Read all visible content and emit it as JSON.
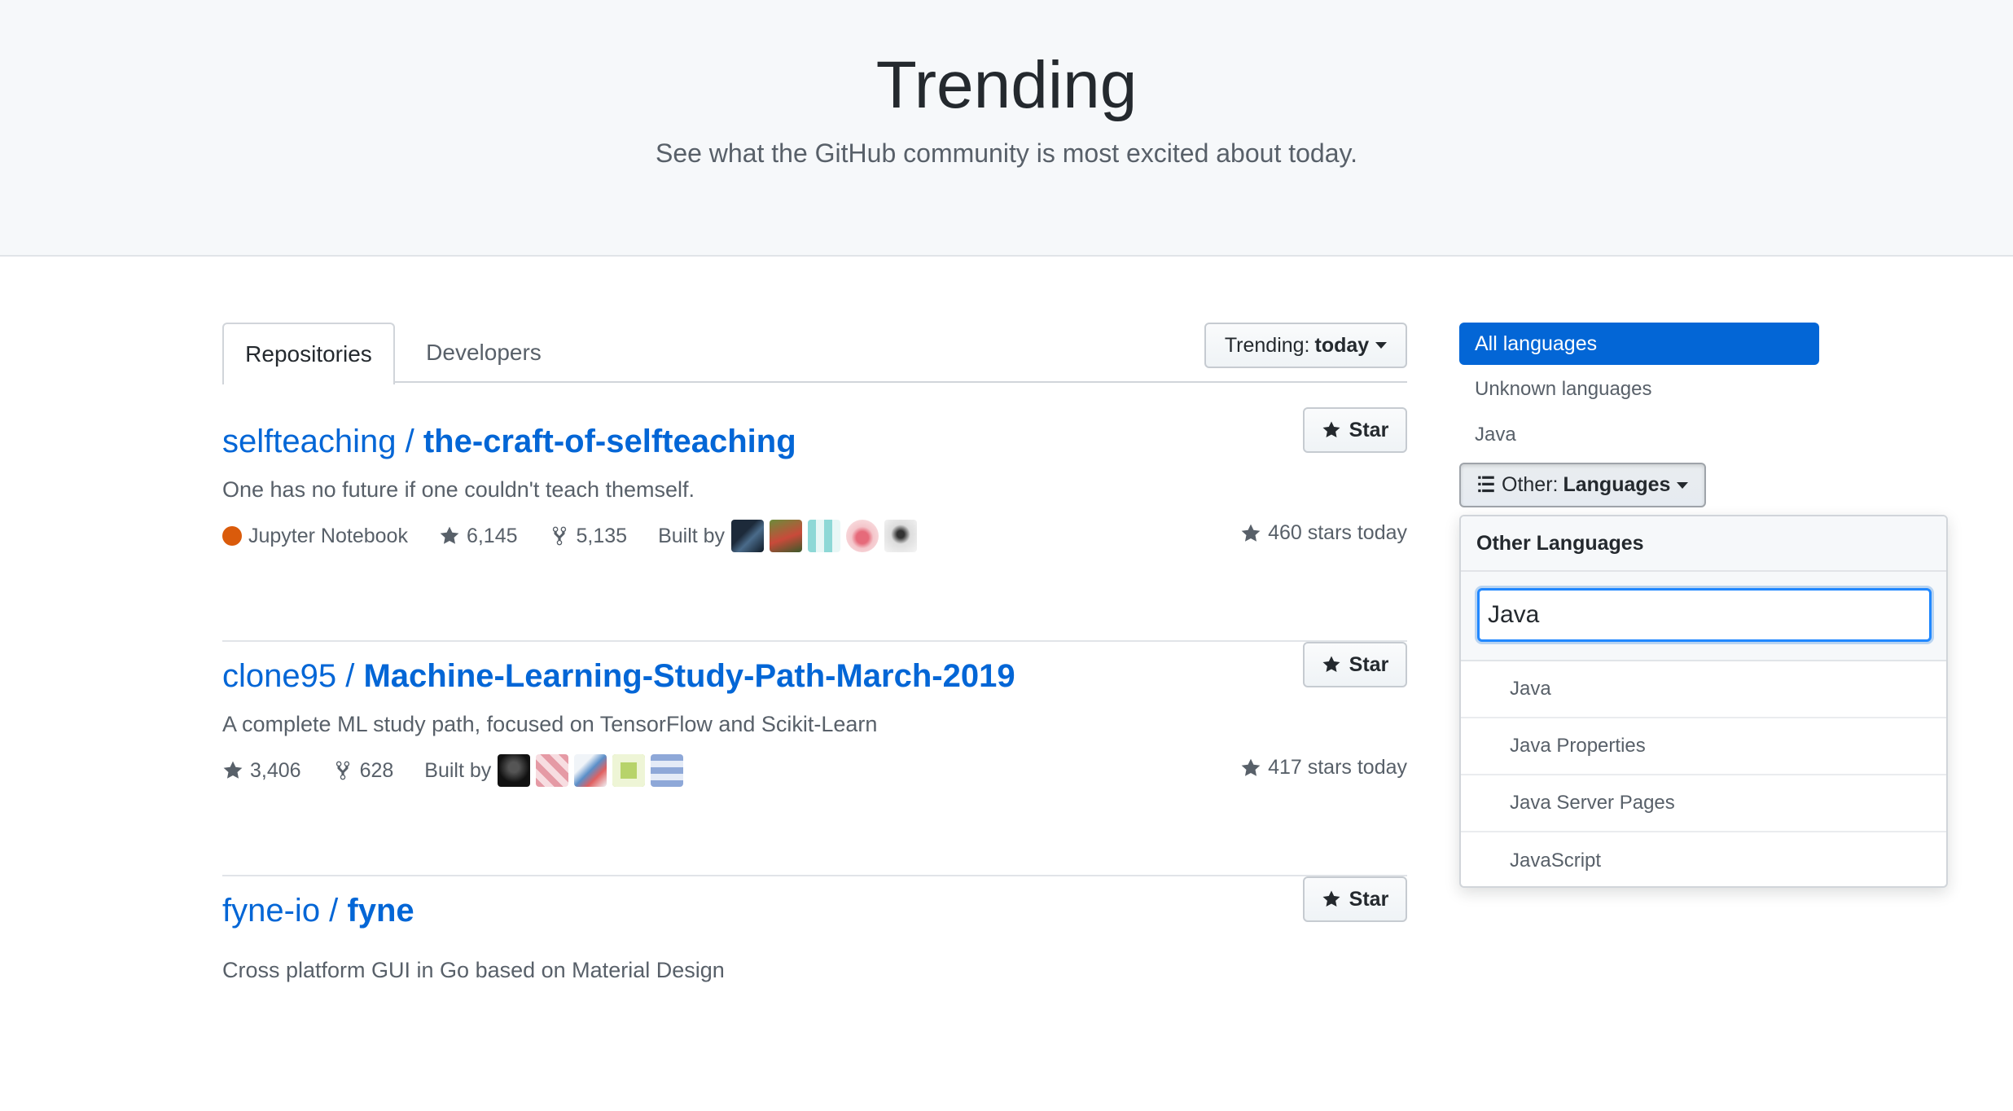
{
  "hero": {
    "title": "Trending",
    "subtitle": "See what the GitHub community is most excited about today."
  },
  "tabs": {
    "repositories": "Repositories",
    "developers": "Developers"
  },
  "trending_filter": {
    "label": "Trending:",
    "value": "today"
  },
  "repos": [
    {
      "owner": "selfteaching / ",
      "name": "the-craft-of-selfteaching",
      "description": "One has no future if one couldn't teach themself.",
      "language": "Jupyter Notebook",
      "language_color": "#DA5B0B",
      "stars": "6,145",
      "forks": "5,135",
      "built_by": "Built by",
      "stars_today": "460 stars today",
      "star_label": "Star"
    },
    {
      "owner": "clone95 / ",
      "name": "Machine-Learning-Study-Path-March-2019",
      "description": "A complete ML study path, focused on TensorFlow and Scikit-Learn",
      "language": "",
      "stars": "3,406",
      "forks": "628",
      "built_by": "Built by",
      "stars_today": "417 stars today",
      "star_label": "Star"
    },
    {
      "owner": "fyne-io / ",
      "name": "fyne",
      "description": "Cross platform GUI in Go based on Material Design",
      "star_label": "Star"
    }
  ],
  "sidebar": {
    "all_languages": "All languages",
    "unknown_languages": "Unknown languages",
    "java": "Java",
    "other_label": "Other:",
    "other_value": "Languages"
  },
  "popover": {
    "header": "Other Languages",
    "filter_value": "Java",
    "items": [
      "Java",
      "Java Properties",
      "Java Server Pages",
      "JavaScript"
    ]
  },
  "colors": {
    "link": "#0366d6",
    "accent": "#0366d6",
    "muted": "#586069"
  }
}
